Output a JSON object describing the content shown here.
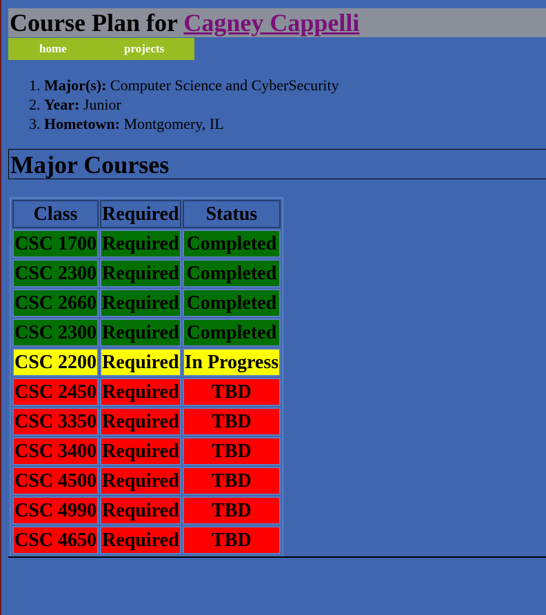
{
  "header": {
    "title_prefix": "Course Plan for",
    "name_link": "Cagney Cappelli"
  },
  "nav": {
    "home": "home",
    "projects": "projects"
  },
  "info": [
    {
      "label": "Major(s):",
      "value": "Computer Science and CyberSecurity"
    },
    {
      "label": "Year:",
      "value": "Junior"
    },
    {
      "label": "Hometown:",
      "value": "Montgomery, IL"
    }
  ],
  "section_title": "Major Courses",
  "table": {
    "headers": [
      "Class",
      "Required",
      "Status"
    ],
    "rows": [
      {
        "class": "CSC 1700",
        "required": "Required",
        "status": "Completed",
        "state": "completed"
      },
      {
        "class": "CSC 2300",
        "required": "Required",
        "status": "Completed",
        "state": "completed"
      },
      {
        "class": "CSC 2660",
        "required": "Required",
        "status": "Completed",
        "state": "completed"
      },
      {
        "class": "CSC 2300",
        "required": "Required",
        "status": "Completed",
        "state": "completed"
      },
      {
        "class": "CSC 2200",
        "required": "Required",
        "status": "In Progress",
        "state": "progress"
      },
      {
        "class": "CSC 2450",
        "required": "Required",
        "status": "TBD",
        "state": "tbd"
      },
      {
        "class": "CSC 3350",
        "required": "Required",
        "status": "TBD",
        "state": "tbd"
      },
      {
        "class": "CSC 3400",
        "required": "Required",
        "status": "TBD",
        "state": "tbd"
      },
      {
        "class": "CSC 4500",
        "required": "Required",
        "status": "TBD",
        "state": "tbd"
      },
      {
        "class": "CSC 4990",
        "required": "Required",
        "status": "TBD",
        "state": "tbd"
      },
      {
        "class": "CSC 4650",
        "required": "Required",
        "status": "TBD",
        "state": "tbd"
      }
    ]
  },
  "colors": {
    "page_bg": "#4166b0",
    "header_bg": "#8a8f99",
    "nav_bg": "#97bd22",
    "link": "#7a107a",
    "completed": "#037003",
    "in_progress": "#ffff00",
    "tbd": "#ff0000"
  }
}
